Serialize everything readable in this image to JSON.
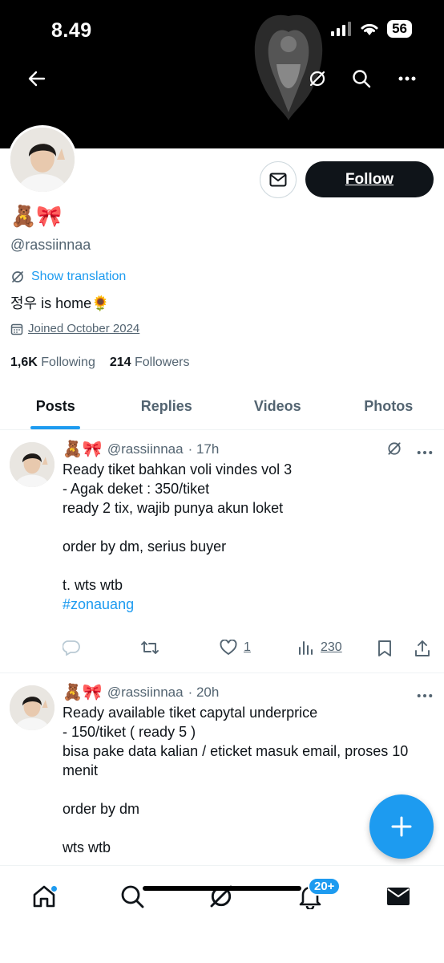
{
  "status_bar": {
    "time": "8.49",
    "battery": "56"
  },
  "profile": {
    "display_name": "🧸🎀",
    "handle": "@rassiinnaa",
    "show_translation": "Show translation",
    "bio": "정우 is home🌻",
    "joined": "Joined October 2024",
    "following_count": "1,6K",
    "following_label": "Following",
    "followers_count": "214",
    "followers_label": "Followers",
    "follow_label": "Follow"
  },
  "tabs": [
    {
      "label": "Posts",
      "active": true
    },
    {
      "label": "Replies",
      "active": false
    },
    {
      "label": "Videos",
      "active": false
    },
    {
      "label": "Photos",
      "active": false
    }
  ],
  "posts": [
    {
      "name": "🧸🎀",
      "handle": "@rassiinnaa",
      "time": "· 17h",
      "body": "Ready tiket bahkan voli vindes vol 3\n- Agak deket : 350/tiket\nready 2 tix, wajib punya akun loket\n\norder by dm, serius buyer\n\nt. wts wtb\n",
      "hashtag": "#zonauang",
      "likes": "1",
      "views": "230"
    },
    {
      "name": "🧸🎀",
      "handle": "@rassiinnaa",
      "time": "· 20h",
      "body": "Ready available tiket capytal underprice\n- 150/tiket ( ready 5 )\nbisa pake data kalian / eticket masuk email, proses 10\nmenit\n\norder by dm\n\nwts wtb"
    }
  ],
  "bottom_nav": {
    "notifications_badge": "20+"
  },
  "colors": {
    "accent": "#1d9bf0",
    "text": "#0f1419",
    "muted": "#536471"
  }
}
